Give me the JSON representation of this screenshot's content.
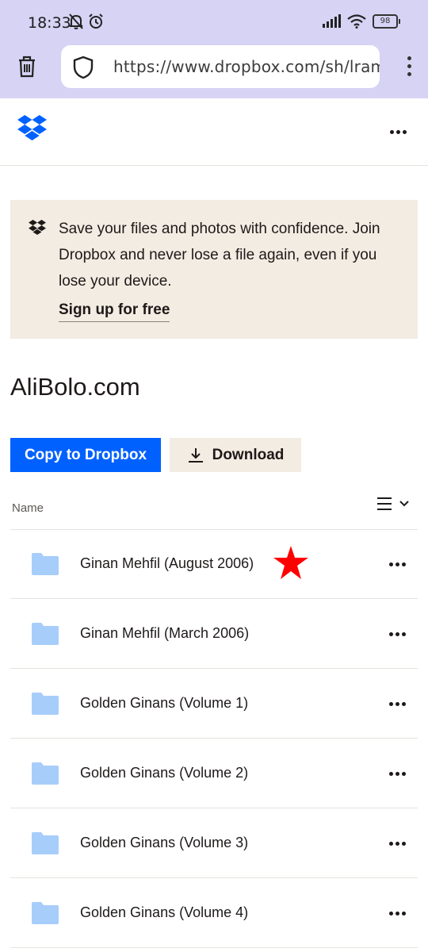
{
  "status_bar": {
    "time": "18:33",
    "battery": "98"
  },
  "browser": {
    "url": "https://www.dropbox.com/sh/lramvc"
  },
  "banner": {
    "text": "Save your files and photos with confidence. Join Dropbox and never lose a file again, even if you lose your device.",
    "signup_label": "Sign up for free"
  },
  "page": {
    "title": "AliBolo.com"
  },
  "actions": {
    "copy_label": "Copy to Dropbox",
    "download_label": "Download"
  },
  "list": {
    "column_name": "Name",
    "items": [
      {
        "name": "Ginan Mehfil (August 2006)"
      },
      {
        "name": "Ginan Mehfil (March 2006)"
      },
      {
        "name": "Golden Ginans (Volume 1)"
      },
      {
        "name": "Golden Ginans (Volume 2)"
      },
      {
        "name": "Golden Ginans (Volume 3)"
      },
      {
        "name": "Golden Ginans (Volume 4)"
      }
    ]
  },
  "colors": {
    "accent": "#0061fe",
    "banner_bg": "#f3ece2",
    "browser_bar": "#d6d3f4",
    "folder": "#a7cdfb",
    "star_marker": "#ff0000"
  },
  "icons": [
    "mute-icon",
    "alarm-icon",
    "signal-icon",
    "wifi-icon",
    "battery-icon",
    "trash-icon",
    "shield-icon",
    "menu-icon",
    "dropbox-logo-icon",
    "more-icon",
    "download-icon",
    "list-view-icon",
    "chevron-down-icon",
    "folder-icon",
    "star-marker-icon"
  ]
}
